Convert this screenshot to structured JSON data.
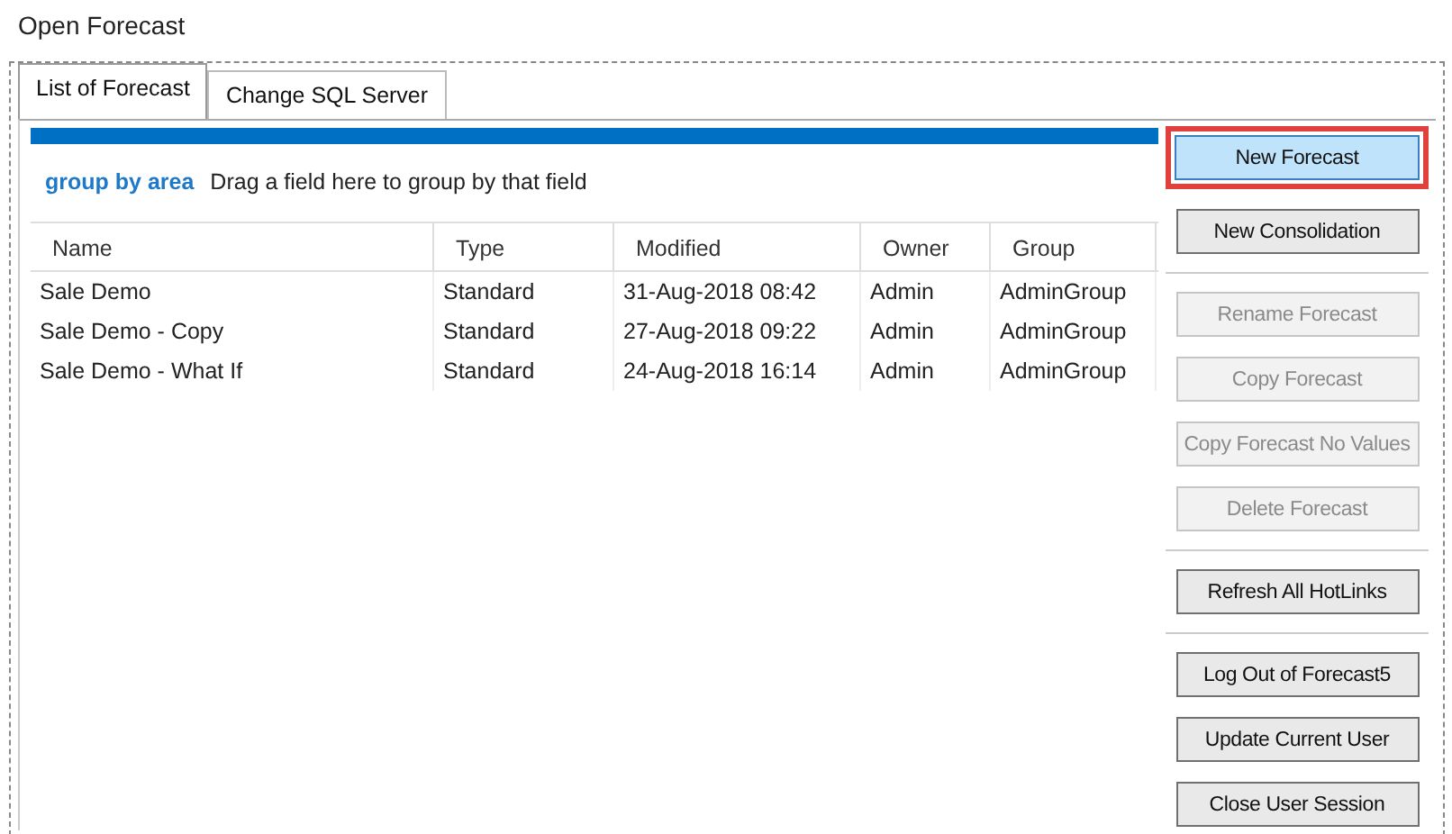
{
  "window": {
    "title": "Open Forecast"
  },
  "tabs": [
    {
      "label": "List of Forecast",
      "selected": true
    },
    {
      "label": "Change SQL Server",
      "selected": false
    }
  ],
  "group_by": {
    "label": "group by area",
    "hint": "Drag a field here to group by that field"
  },
  "table": {
    "columns": [
      "Name",
      "Type",
      "Modified",
      "Owner",
      "Group"
    ],
    "rows": [
      [
        "Sale Demo",
        "Standard",
        "31-Aug-2018 08:42",
        "Admin",
        "AdminGroup"
      ],
      [
        "Sale Demo - Copy",
        "Standard",
        "27-Aug-2018 09:22",
        "Admin",
        "AdminGroup"
      ],
      [
        "Sale Demo - What If",
        "Standard",
        "24-Aug-2018 16:14",
        "Admin",
        "AdminGroup"
      ]
    ]
  },
  "button_groups": [
    [
      {
        "label": "New Forecast",
        "disabled": false,
        "focused": true
      },
      {
        "label": "New Consolidation",
        "disabled": false,
        "focused": false
      }
    ],
    [
      {
        "label": "Rename Forecast",
        "disabled": true,
        "focused": false
      },
      {
        "label": "Copy Forecast",
        "disabled": true,
        "focused": false
      },
      {
        "label": "Copy Forecast No Values",
        "disabled": true,
        "focused": false
      },
      {
        "label": "Delete Forecast",
        "disabled": true,
        "focused": false
      }
    ],
    [
      {
        "label": "Refresh All HotLinks",
        "disabled": false,
        "focused": false
      }
    ],
    [
      {
        "label": "Log Out of Forecast5",
        "disabled": false,
        "focused": false
      },
      {
        "label": "Update Current User",
        "disabled": false,
        "focused": false
      },
      {
        "label": "Close User Session",
        "disabled": false,
        "focused": false
      }
    ]
  ]
}
